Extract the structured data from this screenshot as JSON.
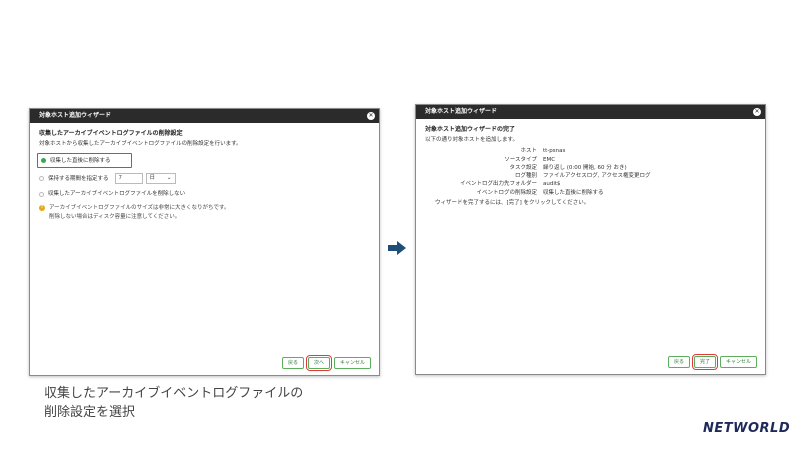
{
  "left_dialog": {
    "title": "対象ホスト追加ウィザード",
    "heading": "収集したアーカイブイベントログファイルの削除設定",
    "description": "対象ホストから収集したアーカイブイベントログファイルの削除設定を行います。",
    "options": [
      {
        "label": "収集した直後に削除する",
        "selected": true
      },
      {
        "label": "保持する期間を指定する",
        "selected": false
      },
      {
        "label": "収集したアーカイブイベントログファイルを削除しない",
        "selected": false
      }
    ],
    "period_value": "7",
    "period_unit": "日",
    "warning_line1": "アーカイブイベントログファイルのサイズは非常に大きくなりがちです。",
    "warning_line2": "削除しない場合はディスク容量に注意してください。",
    "buttons": {
      "back": "戻る",
      "next": "次へ",
      "cancel": "キャンセル"
    }
  },
  "right_dialog": {
    "title": "対象ホスト追加ウィザード",
    "heading": "対象ホスト追加ウィザードの完了",
    "description": "以下の通り対象ホストを追加します。",
    "summary": [
      {
        "key": "ホスト",
        "value": "tt-psnas"
      },
      {
        "key": "ソースタイプ",
        "value": "EMC"
      },
      {
        "key": "タスク設定",
        "value": "繰り返し (0:00 開始, 60 分 おき)"
      },
      {
        "key": "ログ種別",
        "value": "ファイルアクセスログ, アクセス権変更ログ"
      },
      {
        "key": "イベントログ出力先フォルダー",
        "value": "audit$"
      },
      {
        "key": "イベントログの削除設定",
        "value": "収集した直後に削除する"
      }
    ],
    "finish_note": "ウィザードを完了するには、[完了] をクリックしてください。",
    "buttons": {
      "back": "戻る",
      "finish": "完了",
      "cancel": "キャンセル"
    }
  },
  "caption_line1": "収集したアーカイブイベントログファイルの",
  "caption_line2": "削除設定を選択",
  "logo": "NETWORLD",
  "colors": {
    "titlebar": "#2b2b2b",
    "highlight": "#e03a3a",
    "button": "#5cae5c",
    "arrow": "#1f4e79"
  }
}
